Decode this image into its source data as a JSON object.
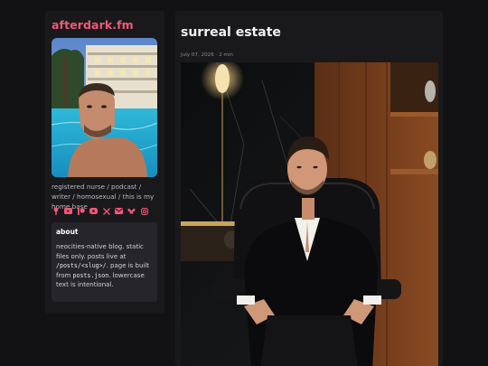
{
  "site": {
    "name": "afterdark.fm",
    "bio": "registered nurse / podcast / writer / homosexual / this is my home base"
  },
  "social_icons": [
    "podcast-icon",
    "youtube-icon",
    "patreon-icon",
    "video-icon",
    "x-icon",
    "mail-icon",
    "bluesky-icon",
    "instagram-icon"
  ],
  "about": {
    "heading": "about",
    "text_1": "neocities-native blog. static files only. posts live at ",
    "code_1": "/posts/<slug>/",
    "text_2": ". page is built from ",
    "code_2": "posts.json",
    "text_3": ". lowercase text is intentional."
  },
  "post": {
    "title": "surreal estate",
    "meta": "July 07, 2026 · 2 min"
  },
  "colors": {
    "accent": "#f0587a",
    "page_bg": "#121214",
    "card_bg": "#19191c",
    "about_bg": "#25252a"
  }
}
